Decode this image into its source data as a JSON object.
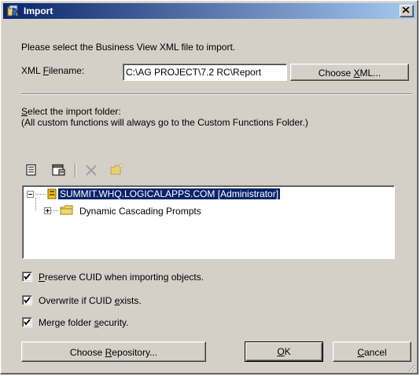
{
  "window": {
    "title": "Import",
    "close_glyph": "×"
  },
  "intro": {
    "text": "Please select the Business View XML file to import."
  },
  "xml_filename": {
    "label_prefix": "XML ",
    "label_accel": "F",
    "label_suffix": "ilename:",
    "value": "C:\\AG PROJECT\\7.2 RC\\Report",
    "choose_prefix": "Choose ",
    "choose_accel": "X",
    "choose_suffix": "ML..."
  },
  "folder_section": {
    "line1_accel": "S",
    "line1_rest": "elect the import folder:",
    "line2": "(All custom functions will always go to the Custom Functions Folder.)"
  },
  "toolbar": {
    "icons": [
      "properties-icon",
      "folder-properties-icon",
      "delete-icon",
      "new-folder-icon"
    ]
  },
  "tree": {
    "root_label": "SUMMIT.WHQ.LOGICALAPPS.COM [Administrator]",
    "child_label": "Dynamic Cascading Prompts"
  },
  "options": {
    "preserve_cuid": {
      "accel": "P",
      "rest": "reserve CUID when importing objects.",
      "checked": true
    },
    "overwrite": {
      "prefix": "Overwrite if CUID ",
      "accel": "e",
      "rest": "xists.",
      "checked": true
    },
    "merge_security": {
      "prefix": "Merge folder ",
      "accel": "s",
      "rest": "ecurity.",
      "checked": true
    }
  },
  "buttons": {
    "choose_repo_prefix": "Choose ",
    "choose_repo_accel": "R",
    "choose_repo_rest": "epository...",
    "ok_accel": "O",
    "ok_rest": "K",
    "cancel_accel": "C",
    "cancel_rest": "ancel"
  },
  "colors": {
    "dialog_bg": "#d4d0c8",
    "title_start": "#0a246a",
    "title_end": "#a6caf0",
    "selection": "#0a246a"
  }
}
